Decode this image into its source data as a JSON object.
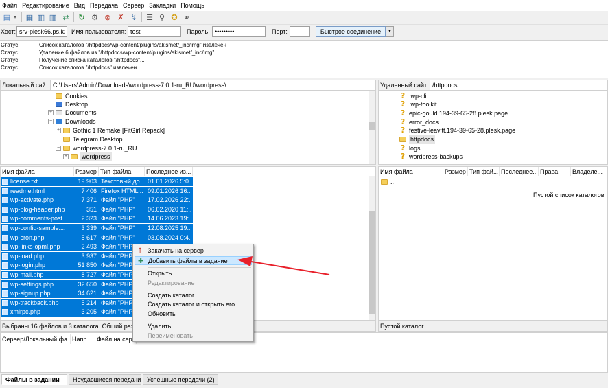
{
  "menu": [
    "Файл",
    "Редактирование",
    "Вид",
    "Передача",
    "Сервер",
    "Закладки",
    "Помощь"
  ],
  "quickconnect": {
    "host_label": "Хост:",
    "host_value": "srv-plesk66.ps.kz",
    "user_label": "Имя пользователя:",
    "user_value": "test",
    "pass_label": "Пароль:",
    "pass_value": "•••••••••",
    "port_label": "Порт:",
    "port_value": "",
    "connect_label": "Быстрое соединение"
  },
  "log": [
    {
      "k": "Статус:",
      "v": "Список каталогов \"/httpdocs/wp-content/plugins/akismet/_inc/img\" извлечен"
    },
    {
      "k": "Статус:",
      "v": "Удаление 6 файлов из \"/httpdocs/wp-content/plugins/akismet/_inc/img\""
    },
    {
      "k": "Статус:",
      "v": "Получение списка каталогов \"/httpdocs\"..."
    },
    {
      "k": "Статус:",
      "v": "Список каталогов \"/httpdocs\" извлечен"
    }
  ],
  "local": {
    "site_label": "Локальный сайт:",
    "site_path": "C:\\Users\\Admin\\Downloads\\wordpress-7.0.1-ru_RU\\wordpress\\",
    "tree": [
      "Cookies",
      "Desktop",
      "Documents",
      "Downloads",
      "Gothic 1 Remake [FitGirl Repack]",
      "Telegram Desktop",
      "wordpress-7.0.1-ru_RU",
      "wordpress"
    ],
    "headers": [
      "Имя файла",
      "Размер",
      "Тип файла",
      "Последнее из..."
    ],
    "files": [
      {
        "name": "license.txt",
        "size": "19 903",
        "type": "Текстовый до...",
        "date": "01.01.2026 5:0..."
      },
      {
        "name": "readme.html",
        "size": "7 406",
        "type": "Firefox HTML ...",
        "date": "09.01.2026 16:..."
      },
      {
        "name": "wp-activate.php",
        "size": "7 371",
        "type": "Файл \"PHP\"",
        "date": "17.02.2026 22:..."
      },
      {
        "name": "wp-blog-header.php",
        "size": "351",
        "type": "Файл \"PHP\"",
        "date": "06.02.2020 11:..."
      },
      {
        "name": "wp-comments-post...",
        "size": "2 323",
        "type": "Файл \"PHP\"",
        "date": "14.06.2023 19:..."
      },
      {
        "name": "wp-config-sample....",
        "size": "3 339",
        "type": "Файл \"PHP\"",
        "date": "12.08.2025 19:..."
      },
      {
        "name": "wp-cron.php",
        "size": "5 617",
        "type": "Файл \"PHP\"",
        "date": "03.08.2024 0:4..."
      },
      {
        "name": "wp-links-opml.php",
        "size": "2 493",
        "type": "Файл \"PHP\"",
        "date": ""
      },
      {
        "name": "wp-load.php",
        "size": "3 937",
        "type": "Файл \"PHP\"",
        "date": ""
      },
      {
        "name": "wp-login.php",
        "size": "51 850",
        "type": "Файл \"PHP\"",
        "date": ""
      },
      {
        "name": "wp-mail.php",
        "size": "8 727",
        "type": "Файл \"PHP\"",
        "date": ""
      },
      {
        "name": "wp-settings.php",
        "size": "32 650",
        "type": "Файл \"PHP\"",
        "date": ""
      },
      {
        "name": "wp-signup.php",
        "size": "34 621",
        "type": "Файл \"PHP\"",
        "date": ""
      },
      {
        "name": "wp-trackback.php",
        "size": "5 214",
        "type": "Файл \"PHP\"",
        "date": ""
      },
      {
        "name": "xmlrpc.php",
        "size": "3 205",
        "type": "Файл \"PHP\"",
        "date": ""
      }
    ],
    "status": "Выбраны 16 файлов и 3 каталога. Общий разме"
  },
  "remote": {
    "site_label": "Удаленный сайт:",
    "site_path": "/httpdocs",
    "tree": [
      ".wp-cli",
      ".wp-toolkit",
      "epic-gould.194-39-65-28.plesk.page",
      "error_docs",
      "festive-leavitt.194-39-65-28.plesk.page",
      "httpdocs",
      "logs",
      "wordpress-backups"
    ],
    "headers": [
      "Имя файла",
      "Размер",
      "Тип фай...",
      "Последнее...",
      "Права",
      "Владеле..."
    ],
    "parent_dir": "..",
    "empty_list": "Пустой список каталогов",
    "status": "Пустой каталог."
  },
  "context_menu": {
    "items": [
      "Закачать на сервер",
      "Добавить файлы в задание",
      "Открыть",
      "Редактирование",
      "Создать каталог",
      "Создать каталог и открыть его",
      "Обновить",
      "Удалить",
      "Переименовать"
    ]
  },
  "queue": {
    "headers": [
      "Сервер/Локальный фа...",
      "Напр...",
      "Файл на серве"
    ]
  },
  "tabs": [
    "Файлы в задании",
    "Неудавшиеся передачи",
    "Успешные передачи (2)"
  ],
  "colors": {
    "selection": "#0078d7",
    "arrow": "#e8202a"
  }
}
